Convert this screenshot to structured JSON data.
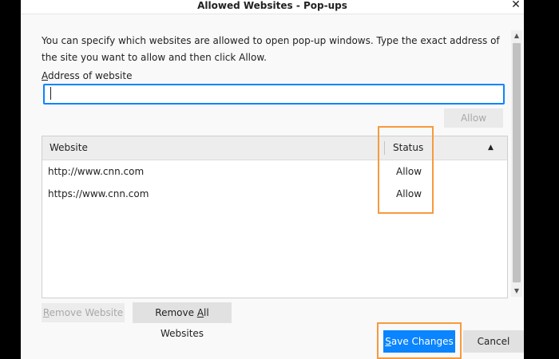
{
  "window": {
    "title": "Allowed Websites - Pop-ups",
    "close_glyph": "✕"
  },
  "dialog": {
    "description": "You can specify which websites are allowed to open pop-up windows. Type the exact address of the site you want to allow and then click Allow.",
    "address_label_accesskey": "A",
    "address_label_rest": "ddress of website",
    "address_value": "",
    "allow_label": "Allow"
  },
  "table": {
    "columns": [
      "Website",
      "Status"
    ],
    "sort_glyph": "▲",
    "rows": [
      {
        "website": "http://www.cnn.com",
        "status": "Allow"
      },
      {
        "website": "https://www.cnn.com",
        "status": "Allow"
      }
    ]
  },
  "scrollbar": {
    "up_glyph": "▲",
    "down_glyph": "▼"
  },
  "buttons": {
    "remove_website_accesskey": "R",
    "remove_website_rest": "emove Website",
    "remove_all_prefix": "Remove ",
    "remove_all_accesskey": "A",
    "remove_all_rest": "ll Websites",
    "save_prefix": "",
    "save_accesskey": "S",
    "save_rest": "ave Changes",
    "cancel_label": "Cancel"
  },
  "colors": {
    "accent": "#0a84ff",
    "highlight": "#f79a3d",
    "dialog_bg": "#f9f9fa",
    "backdrop": "#000000"
  }
}
